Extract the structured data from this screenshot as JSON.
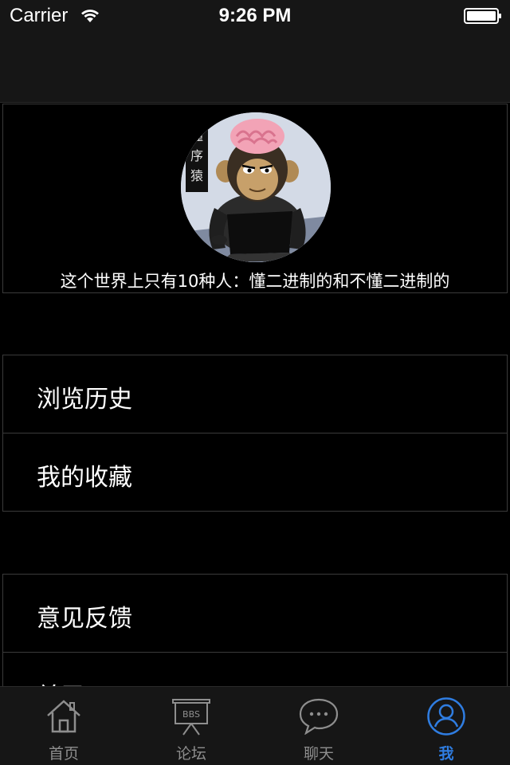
{
  "status_bar": {
    "carrier": "Carrier",
    "time": "9:26 PM"
  },
  "profile": {
    "motto": "这个世界上只有10种人：懂二进制的和不懂二进制的",
    "avatar_caption": "懂程序猿"
  },
  "menu_groups": [
    {
      "items": [
        {
          "label": "浏览历史"
        },
        {
          "label": "我的收藏"
        }
      ]
    },
    {
      "items": [
        {
          "label": "意见反馈"
        },
        {
          "label": "关于OpenChina"
        }
      ]
    }
  ],
  "tab_bar": {
    "items": [
      {
        "label": "首页",
        "icon": "home-icon",
        "active": false
      },
      {
        "label": "论坛",
        "icon": "bbs-board-icon",
        "active": false
      },
      {
        "label": "聊天",
        "icon": "chat-bubble-icon",
        "active": false
      },
      {
        "label": "我",
        "icon": "user-profile-icon",
        "active": true
      }
    ],
    "icon_text_bbs": "BBS"
  },
  "colors": {
    "background": "#000000",
    "bar_background": "#161616",
    "accent": "#2f7de1",
    "inactive": "#8e8e8e",
    "border": "#3a3a3a"
  }
}
